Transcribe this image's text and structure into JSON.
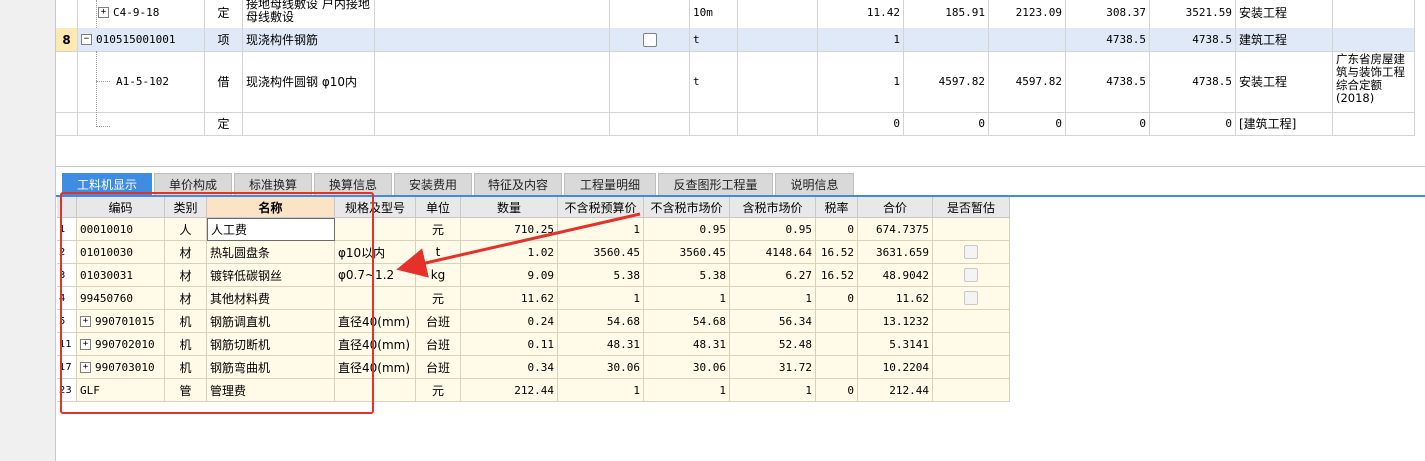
{
  "upper_rows": [
    {
      "rownum": "",
      "code": "C4-9-18",
      "type": "定",
      "name": "接地母线敷设 户内接地母线敷设",
      "unit": "10m",
      "qty": "11.42",
      "price1": "185.91",
      "total1": "2123.09",
      "price2": "308.37",
      "total2": "3521.59",
      "category": "安装工程",
      "note": ""
    },
    {
      "rownum": "8",
      "code": "010515001001",
      "type": "项",
      "name": "现浇构件钢筋",
      "unit": "t",
      "qty": "1",
      "price1": "",
      "total1": "",
      "price2": "4738.5",
      "total2": "4738.5",
      "category": "建筑工程",
      "note": ""
    },
    {
      "rownum": "",
      "code": "A1-5-102",
      "type": "借",
      "name": "现浇构件圆钢 φ10内",
      "unit": "t",
      "qty": "1",
      "price1": "4597.82",
      "total1": "4597.82",
      "price2": "4738.5",
      "total2": "4738.5",
      "category": "安装工程",
      "note": "广东省房屋建筑与装饰工程综合定额(2018)"
    },
    {
      "rownum": "",
      "code": "",
      "type": "定",
      "name": "",
      "unit": "",
      "qty": "0",
      "price1": "0",
      "total1": "0",
      "price2": "0",
      "total2": "0",
      "category": "[建筑工程]",
      "note": ""
    }
  ],
  "tabs": [
    "工料机显示",
    "单价构成",
    "标准换算",
    "换算信息",
    "安装费用",
    "特征及内容",
    "工程量明细",
    "反查图形工程量",
    "说明信息"
  ],
  "grid_headers": [
    "",
    "编码",
    "类别",
    "名称",
    "规格及型号",
    "单位",
    "数量",
    "不含税预算价",
    "不含税市场价",
    "含税市场价",
    "税率",
    "合价",
    "是否暂估"
  ],
  "grid_rows": [
    {
      "num": "1",
      "code": "00010010",
      "expand": false,
      "cat": "人",
      "name": "人工费",
      "spec": "",
      "unit": "元",
      "qty": "710.25",
      "p1": "1",
      "p2": "0.95",
      "p3": "0.95",
      "tax": "0",
      "total": "674.7375",
      "est": false
    },
    {
      "num": "2",
      "code": "01010030",
      "expand": false,
      "cat": "材",
      "name": "热轧圆盘条",
      "spec": "φ10以内",
      "unit": "t",
      "qty": "1.02",
      "p1": "3560.45",
      "p2": "3560.45",
      "p3": "4148.64",
      "tax": "16.52",
      "total": "3631.659",
      "est": true
    },
    {
      "num": "3",
      "code": "01030031",
      "expand": false,
      "cat": "材",
      "name": "镀锌低碳钢丝",
      "spec": "φ0.7~1.2",
      "unit": "kg",
      "qty": "9.09",
      "p1": "5.38",
      "p2": "5.38",
      "p3": "6.27",
      "tax": "16.52",
      "total": "48.9042",
      "est": true
    },
    {
      "num": "4",
      "code": "99450760",
      "expand": false,
      "cat": "材",
      "name": "其他材料费",
      "spec": "",
      "unit": "元",
      "qty": "11.62",
      "p1": "1",
      "p2": "1",
      "p3": "1",
      "tax": "0",
      "total": "11.62",
      "est": true
    },
    {
      "num": "5",
      "code": "990701015",
      "expand": true,
      "cat": "机",
      "name": "钢筋调直机",
      "spec": "直径40(mm)",
      "unit": "台班",
      "qty": "0.24",
      "p1": "54.68",
      "p2": "54.68",
      "p3": "56.34",
      "tax": "",
      "total": "13.1232",
      "est": false
    },
    {
      "num": "11",
      "code": "990702010",
      "expand": true,
      "cat": "机",
      "name": "钢筋切断机",
      "spec": "直径40(mm)",
      "unit": "台班",
      "qty": "0.11",
      "p1": "48.31",
      "p2": "48.31",
      "p3": "52.48",
      "tax": "",
      "total": "5.3141",
      "est": false
    },
    {
      "num": "17",
      "code": "990703010",
      "expand": true,
      "cat": "机",
      "name": "钢筋弯曲机",
      "spec": "直径40(mm)",
      "unit": "台班",
      "qty": "0.34",
      "p1": "30.06",
      "p2": "30.06",
      "p3": "31.72",
      "tax": "",
      "total": "10.2204",
      "est": false
    },
    {
      "num": "23",
      "code": "GLF",
      "expand": false,
      "cat": "管",
      "name": "管理费",
      "spec": "",
      "unit": "元",
      "qty": "212.44",
      "p1": "1",
      "p2": "1",
      "p3": "1",
      "tax": "0",
      "total": "212.44",
      "est": false
    }
  ],
  "colors": {
    "accent": "#3f8de2",
    "annotation": "#e5312a",
    "grid_bg": "#fffbe8",
    "selected_row": "#dfe9f7"
  },
  "icons": {
    "expander": "plus-box-icon",
    "checkbox": "checkbox-icon"
  }
}
